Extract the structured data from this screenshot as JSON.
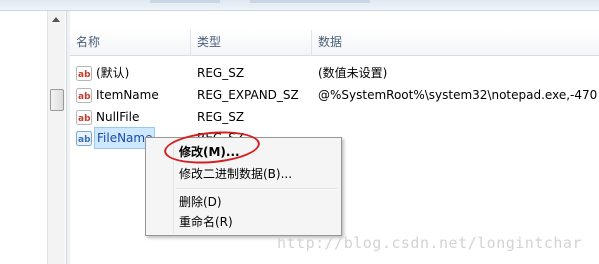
{
  "header": {
    "name": "名称",
    "type": "类型",
    "data": "数据"
  },
  "rows": [
    {
      "name": "(默认)",
      "type": "REG_SZ",
      "data": "(数值未设置)"
    },
    {
      "name": "ItemName",
      "type": "REG_EXPAND_SZ",
      "data": "@%SystemRoot%\\system32\\notepad.exe,-470"
    },
    {
      "name": "NullFile",
      "type": "REG_SZ",
      "data": ""
    },
    {
      "name": "FileName",
      "type": "REG_SZ",
      "data": "",
      "selected": true
    }
  ],
  "icon": "string-value-ab-icon",
  "context_menu": {
    "items": [
      {
        "label": "修改(M)...",
        "default": true,
        "circled": true
      },
      {
        "label": "修改二进制数据(B)..."
      },
      {
        "label": "删除(D)"
      },
      {
        "label": "重命名(R)"
      }
    ]
  },
  "watermark": "http://blog.csdn.net/longintchar",
  "colors": {
    "selection": "#cde8ff",
    "annotation": "#d42020",
    "header_text": "#4c607a"
  }
}
